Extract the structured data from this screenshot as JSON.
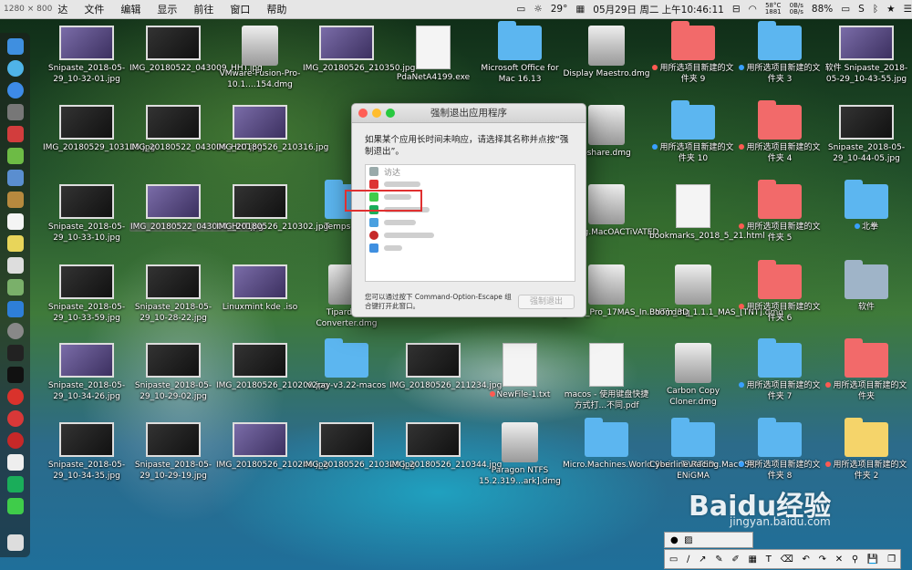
{
  "menubar": {
    "resolution": "1280 × 800",
    "app": "达",
    "items": [
      "文件",
      "编辑",
      "显示",
      "前往",
      "窗口",
      "帮助"
    ],
    "weather": "29°",
    "datetime": "05月29日 周二 上午10:46:11",
    "cpu_temp": "58°C",
    "fan": "1881",
    "net_up": "0B/s",
    "net_down": "0B/s",
    "battery": "88%"
  },
  "desktop": {
    "icons": [
      {
        "name": "Snipaste_2018-05-29_10-32-01.jpg",
        "kind": "img"
      },
      {
        "name": "IMG_20180522_043009_HHT.jpg",
        "kind": "img"
      },
      {
        "name": "VMware-Fusion-Pro-10.1....154.dmg",
        "kind": "dmg"
      },
      {
        "name": "IMG_20180526_210350.jpg",
        "kind": "img"
      },
      {
        "name": "PdaNetA4199.exe",
        "kind": "doc"
      },
      {
        "name": "Microsoft Office for Mac 16.13",
        "kind": "folder"
      },
      {
        "name": "Display Maestro.dmg",
        "kind": "dmg"
      },
      {
        "name": "用所选项目新建的文件夹 9",
        "kind": "folder",
        "tag": "r"
      },
      {
        "name": "用所选项目新建的文件夹 3",
        "kind": "folder",
        "tag": "b"
      },
      {
        "name": "软件 Snipaste_2018-05-29_10-43-55.jpg",
        "kind": "img"
      },
      {
        "name": "IMG_20180529_103115.jpg",
        "kind": "img"
      },
      {
        "name": "IMG_20180522_043006_HHT.jpg",
        "kind": "img"
      },
      {
        "name": "IMG_20180526_210316.jpg",
        "kind": "img"
      },
      {
        "name": "oshare.dmg",
        "kind": "dmg"
      },
      {
        "name": "用所选项目新建的文件夹 10",
        "kind": "folder",
        "tag": "b"
      },
      {
        "name": "用所选项目新建的文件夹 4",
        "kind": "folder",
        "tag": "r"
      },
      {
        "name": "Snipaste_2018-05-29_10-44-05.jpg",
        "kind": "img"
      },
      {
        "name": "Snipaste_2018-05-29_10-33-10.jpg",
        "kind": "img"
      },
      {
        "name": "IMG_20180522_043004_HHT.jpg",
        "kind": "img"
      },
      {
        "name": "IMG_20180526_210302.jpg",
        "kind": "img"
      },
      {
        "name": "Temps-x64",
        "kind": "folder"
      },
      {
        "name": "e.King.MacOACTiVATED",
        "kind": "dmg"
      },
      {
        "name": "bookmarks_2018_5_21.html",
        "kind": "doc"
      },
      {
        "name": "用所选项目新建的文件夹 5",
        "kind": "folder",
        "tag": "r"
      },
      {
        "name": "北拳",
        "kind": "folder",
        "tag": "b"
      },
      {
        "name": "Snipaste_2018-05-29_10-33-59.jpg",
        "kind": "img"
      },
      {
        "name": "Snipaste_2018-05-29_10-28-22.jpg",
        "kind": "img"
      },
      {
        "name": "Linuxmint kde .iso",
        "kind": "img"
      },
      {
        "name": "Tipard MP Converter.dmg",
        "kind": "dmg"
      },
      {
        "name": "_Flow_Pro_17MAS_In...NT].dmg",
        "kind": "dmg"
      },
      {
        "name": "Boom_3D_1.1.1_MAS_[TNT].dmg",
        "kind": "dmg"
      },
      {
        "name": "用所选项目新建的文件夹 6",
        "kind": "folder",
        "tag": "r"
      },
      {
        "name": "软件",
        "kind": "folder"
      },
      {
        "name": "Snipaste_2018-05-29_10-34-26.jpg",
        "kind": "img"
      },
      {
        "name": "Snipaste_2018-05-29_10-29-02.jpg",
        "kind": "img"
      },
      {
        "name": "IMG_20180526_210209.jpg",
        "kind": "img"
      },
      {
        "name": "v2ray-v3.22-macos",
        "kind": "folder"
      },
      {
        "name": "IMG_20180526_211234.jpg",
        "kind": "img"
      },
      {
        "name": "NewFile-1.txt",
        "kind": "doc",
        "tag": "r"
      },
      {
        "name": "macos - 使用键盘快捷方式打...不同.pdf",
        "kind": "doc"
      },
      {
        "name": "Carbon Copy Cloner.dmg",
        "kind": "dmg"
      },
      {
        "name": "用所选项目新建的文件夹 7",
        "kind": "folder",
        "tag": "b"
      },
      {
        "name": "用所选项目新建的文件夹",
        "kind": "folder",
        "tag": "r"
      },
      {
        "name": "Snipaste_2018-05-29_10-34-35.jpg",
        "kind": "img"
      },
      {
        "name": "Snipaste_2018-05-29_10-29-19.jpg",
        "kind": "img"
      },
      {
        "name": "IMG_20180526_210246.jpg",
        "kind": "img"
      },
      {
        "name": "IMG_20180526_210328.jpg",
        "kind": "img"
      },
      {
        "name": "IMG_20180526_210344.jpg",
        "kind": "img"
      },
      {
        "name": "Paragon NTFS 15.2.319...ark].dmg",
        "kind": "dmg"
      },
      {
        "name": "Micro.Machines.World.Seri....TiVATED",
        "kind": "folder"
      },
      {
        "name": "Cyberline.Racing.MacOSX-ENiGMA",
        "kind": "folder"
      },
      {
        "name": "用所选项目新建的文件夹 8",
        "kind": "folder",
        "tag": "b"
      },
      {
        "name": "用所选项目新建的文件夹 2",
        "kind": "folder",
        "tag": "r"
      }
    ]
  },
  "dialog": {
    "title": "强制退出应用程序",
    "message": "如果某个应用长时间未响应，请选择其名称并点按“强制退出”。",
    "apps": [
      "访达"
    ],
    "footer": "您可以通过按下 Command-Option-Escape 组合键打开此窗口。",
    "force_quit_label": "强制退出"
  },
  "watermark": {
    "brand": "Baidu经验",
    "url": "jingyan.baidu.com"
  }
}
